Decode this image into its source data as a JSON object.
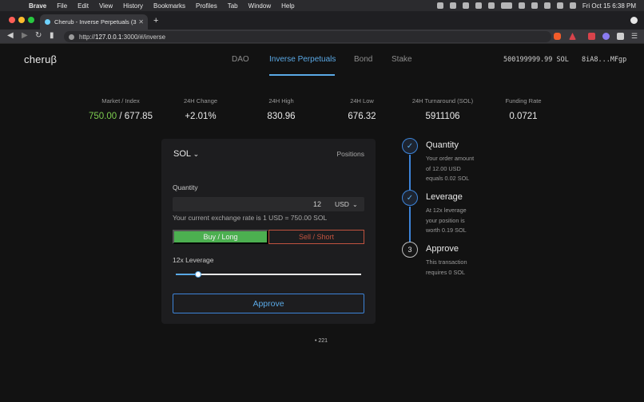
{
  "os_menubar": {
    "app_name": "Brave",
    "menus": [
      "File",
      "Edit",
      "View",
      "History",
      "Bookmarks",
      "Profiles",
      "Tab",
      "Window",
      "Help"
    ],
    "clock": "Fri Oct 15  6:38 PM"
  },
  "browser": {
    "tab_title": "Cherub - Inverse Perpetuals (3",
    "url_prefix": "http://",
    "url_host": "127.0.0.1",
    "url_rest": ":3000/#/inverse"
  },
  "header": {
    "logo": "cheruβ",
    "nav": [
      {
        "label": "DAO",
        "active": false
      },
      {
        "label": "Inverse Perpetuals",
        "active": true
      },
      {
        "label": "Bond",
        "active": false
      },
      {
        "label": "Stake",
        "active": false
      }
    ],
    "balance": "500199999.99 SOL",
    "wallet": "8iA8...MFgp"
  },
  "stats": {
    "market_index": {
      "label": "Market / Index",
      "market": "750.00",
      "index": " / 677.85"
    },
    "change": {
      "label": "24H Change",
      "value": "+2.01%"
    },
    "high": {
      "label": "24H High",
      "value": "830.96"
    },
    "low": {
      "label": "24H Low",
      "value": "676.32"
    },
    "turnaround": {
      "label": "24H Turnaround (SOL)",
      "value": "5911106"
    },
    "funding": {
      "label": "Funding Rate",
      "value": "0.0721"
    }
  },
  "order": {
    "market_select": "SOL",
    "positions_label": "Positions",
    "quantity_label": "Quantity",
    "quantity_value": "12",
    "quantity_unit": "USD",
    "rate_text": "Your current exchange rate is 1 USD = 750.00 SOL",
    "buy_label": "Buy / Long",
    "sell_label": "Sell / Short",
    "leverage_label": "12x Leverage",
    "leverage_fraction": 0.12,
    "approve_label": "Approve",
    "footnote": "• 221"
  },
  "steps": [
    {
      "marker": "✓",
      "title": "Quantity",
      "desc": [
        "Your order amount",
        "of 12.00 USD",
        "equals 0.02 SOL"
      ]
    },
    {
      "marker": "✓",
      "title": "Leverage",
      "desc": [
        "At 12x leverage",
        "your position is",
        "worth 0.19 SOL"
      ]
    },
    {
      "marker": "3",
      "title": "Approve",
      "desc": [
        "This transaction",
        "requires 0 SOL"
      ]
    }
  ],
  "colors": {
    "accent": "#5aa9e6",
    "green": "#7ccc4f",
    "orange": "#f2a03d",
    "sell": "#c0533f"
  }
}
